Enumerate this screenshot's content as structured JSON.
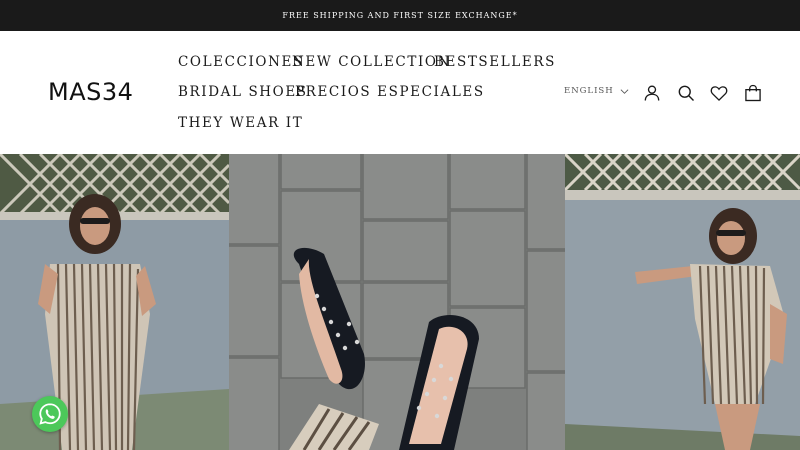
{
  "announcement": {
    "text": "FREE SHIPPING AND FIRST SIZE EXCHANGE*"
  },
  "brand": {
    "logo_text": "MAS34"
  },
  "nav": {
    "items": [
      {
        "label": "COLECCIONES"
      },
      {
        "label": "NEW COLLECTION"
      },
      {
        "label": "BESTSELLERS"
      },
      {
        "label": "BRIDAL SHOES"
      },
      {
        "label": "PRECIOS ESPECIALES"
      },
      {
        "label": "THEY WEAR IT"
      }
    ]
  },
  "header": {
    "language": "ENGLISH",
    "icons": [
      "user-icon",
      "search-icon",
      "heart-icon",
      "bag-icon"
    ]
  },
  "hero": {
    "panels": [
      "woman-striped-jumpsuit-left-photo",
      "studded-sandals-on-pavement-photo",
      "woman-striped-jumpsuit-right-photo"
    ]
  },
  "floating": {
    "icon": "whatsapp-icon"
  },
  "colors": {
    "announcement_bg": "#1a1a1a",
    "whatsapp_green": "#4cc85a"
  }
}
